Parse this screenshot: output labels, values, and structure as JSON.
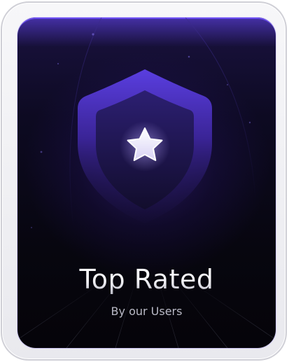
{
  "badge": {
    "title": "Top Rated",
    "subtitle": "By our Users",
    "icon": "star-icon",
    "emblem": "shield-icon"
  },
  "colors": {
    "accent": "#6a4cf0",
    "background": "#07060f",
    "shield_outer": "#4b2fc0",
    "shield_inner": "#241a5c",
    "star": "#ffffff"
  }
}
